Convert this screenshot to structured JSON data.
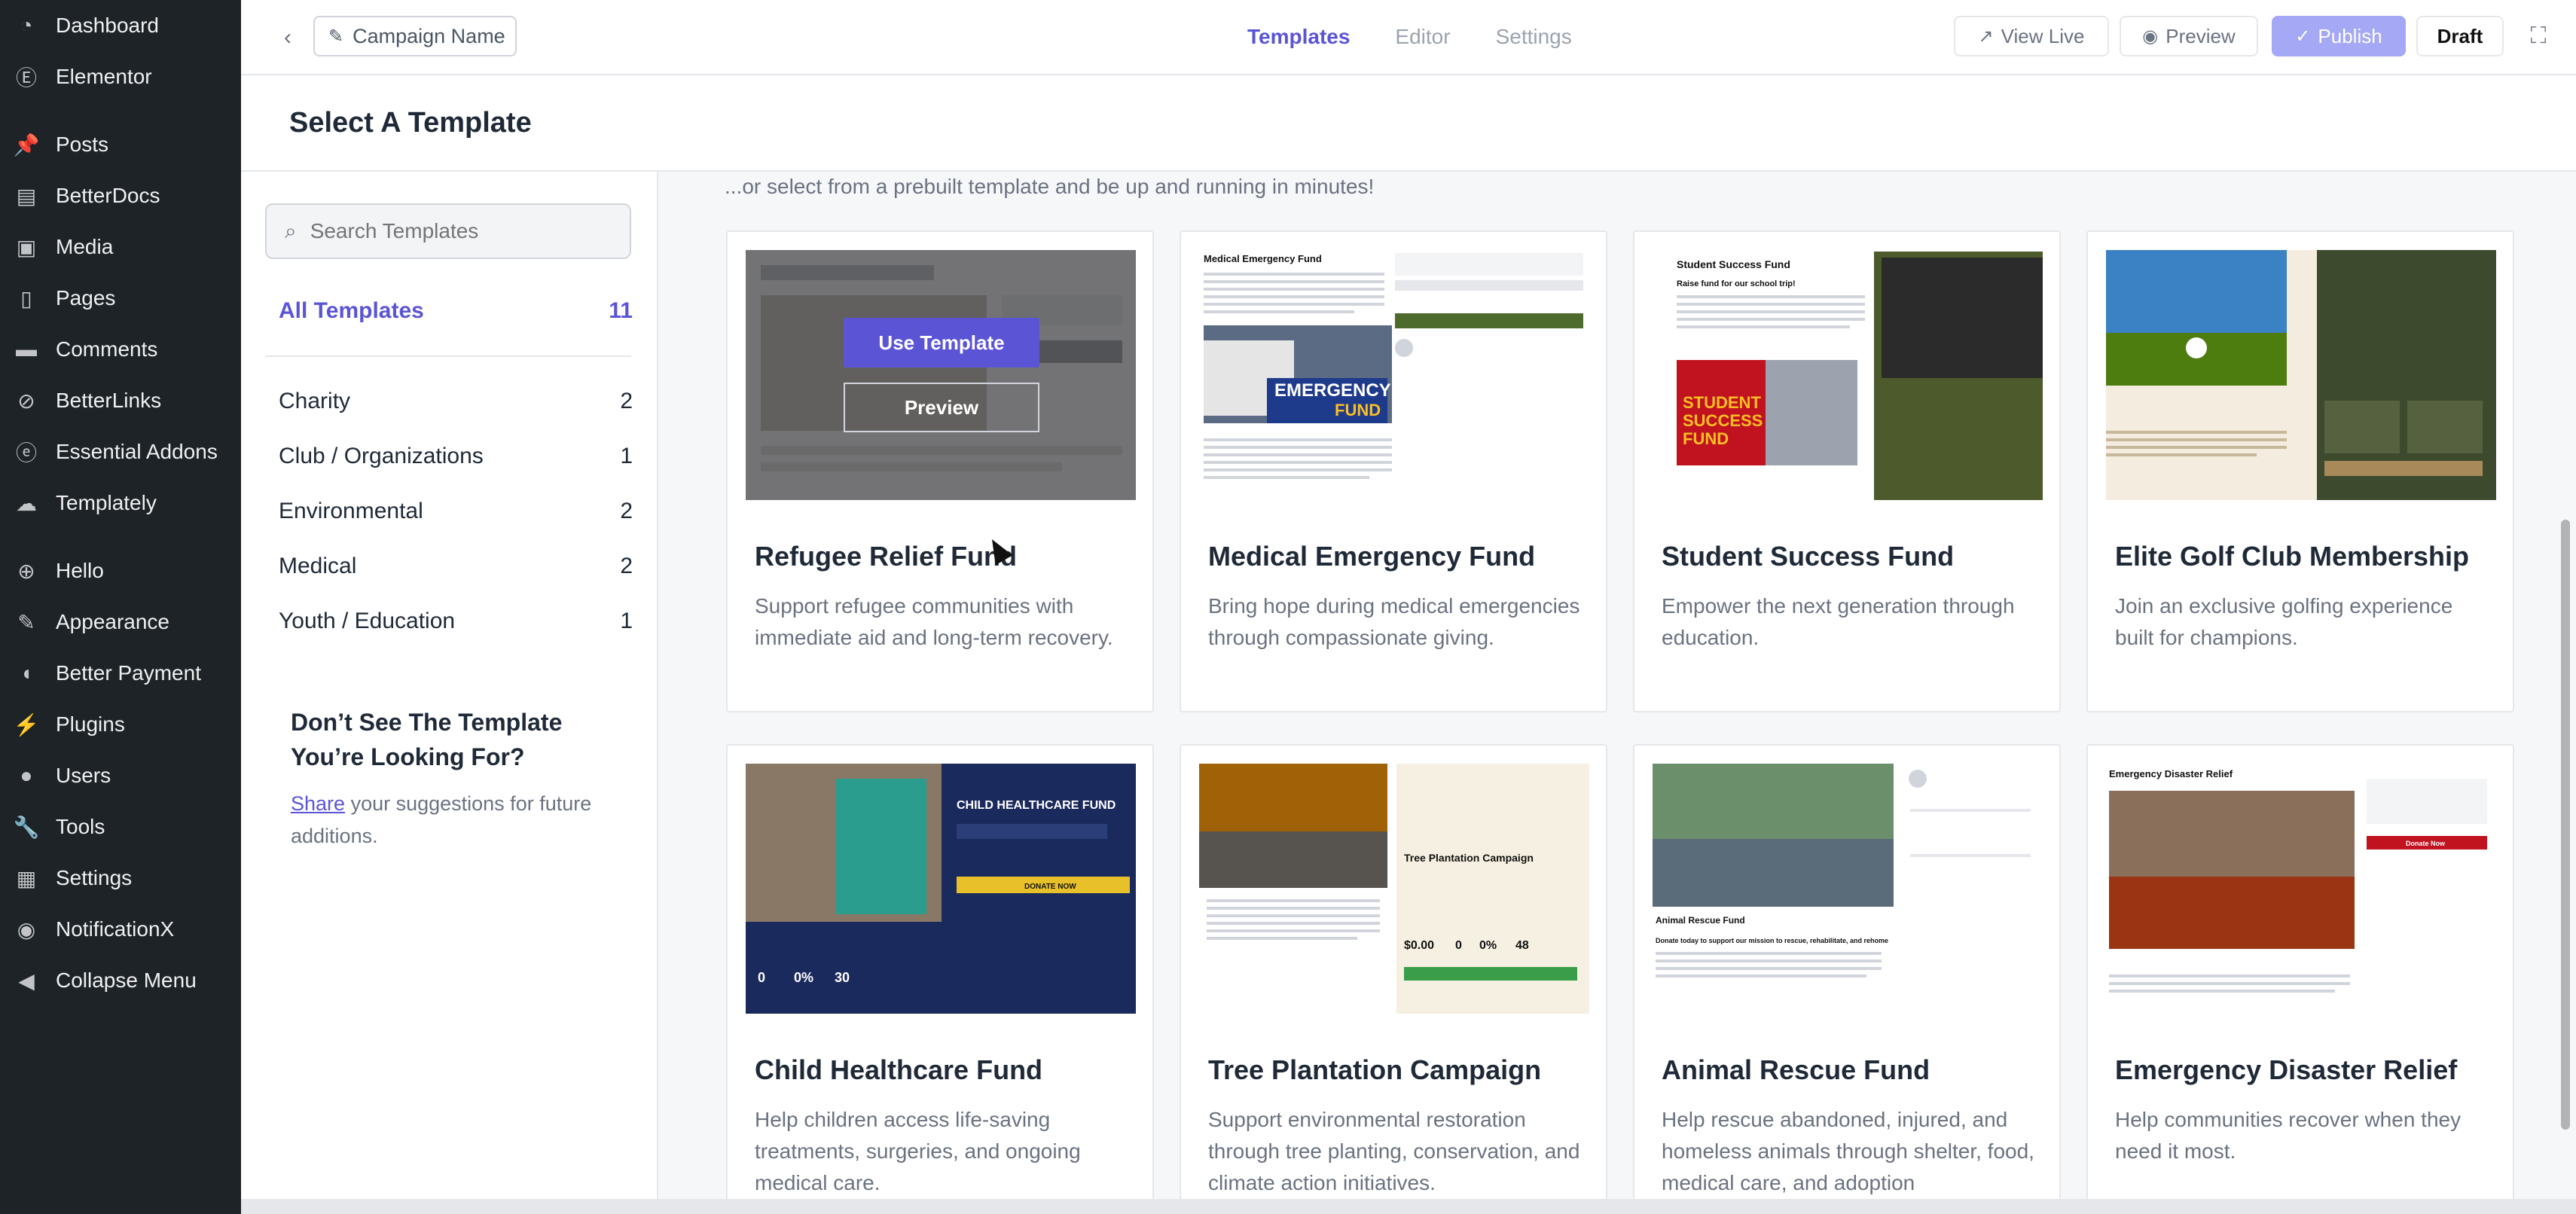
{
  "wp_menu": [
    {
      "label": "Dashboard",
      "icon": "dashboard-icon"
    },
    {
      "label": "Elementor",
      "icon": "elementor-icon"
    },
    {
      "label": "Posts",
      "icon": "pin-icon"
    },
    {
      "label": "BetterDocs",
      "icon": "docs-icon"
    },
    {
      "label": "Media",
      "icon": "media-icon"
    },
    {
      "label": "Pages",
      "icon": "page-icon"
    },
    {
      "label": "Comments",
      "icon": "comment-icon"
    },
    {
      "label": "BetterLinks",
      "icon": "link-icon"
    },
    {
      "label": "Essential Addons",
      "icon": "ea-icon"
    },
    {
      "label": "Templately",
      "icon": "templately-icon"
    },
    {
      "label": "Hello",
      "icon": "plus-circle-icon"
    },
    {
      "label": "Appearance",
      "icon": "brush-icon"
    },
    {
      "label": "Better Payment",
      "icon": "payment-icon"
    },
    {
      "label": "Plugins",
      "icon": "plug-icon"
    },
    {
      "label": "Users",
      "icon": "user-icon"
    },
    {
      "label": "Tools",
      "icon": "wrench-icon"
    },
    {
      "label": "Settings",
      "icon": "settings-icon"
    },
    {
      "label": "NotificationX",
      "icon": "notification-icon"
    },
    {
      "label": "Collapse Menu",
      "icon": "collapse-icon"
    }
  ],
  "topbar": {
    "campaign_name": "Campaign Name",
    "tabs": [
      "Templates",
      "Editor",
      "Settings"
    ],
    "view_live": "View Live",
    "preview": "Preview",
    "publish": "Publish",
    "draft": "Draft"
  },
  "page": {
    "title": "Select A Template",
    "intro": "...or select from a prebuilt template and be up and running in minutes!"
  },
  "sidebar": {
    "search_placeholder": "Search Templates",
    "all": {
      "label": "All Templates",
      "count": "11"
    },
    "categories": [
      {
        "label": "Charity",
        "count": "2"
      },
      {
        "label": "Club / Organizations",
        "count": "1"
      },
      {
        "label": "Environmental",
        "count": "2"
      },
      {
        "label": "Medical",
        "count": "2"
      },
      {
        "label": "Youth / Education",
        "count": "1"
      }
    ],
    "suggest_title": "Don’t See The Template You’re Looking For?",
    "suggest_link": "Share",
    "suggest_text": " your suggestions for future additions."
  },
  "templates": [
    {
      "title": "Refugee Relief Fund",
      "desc": "Support refugee communities with immediate aid and long-term recovery.",
      "use_label": "Use Template",
      "preview_label": "Preview"
    },
    {
      "title": "Medical Emergency Fund",
      "desc": "Bring hope during medical emergencies through compassionate giving."
    },
    {
      "title": "Student Success Fund",
      "desc": "Empower the next generation through education."
    },
    {
      "title": "Elite Golf Club Membership",
      "desc": "Join an exclusive golfing experience built for champions."
    },
    {
      "title": "Child Healthcare Fund",
      "desc": "Help children access life-saving treatments, surgeries, and ongoing medical care."
    },
    {
      "title": "Tree Plantation Campaign",
      "desc": "Support environmental restoration through tree planting, conservation, and climate action initiatives."
    },
    {
      "title": "Animal Rescue Fund",
      "desc": "Help rescue abandoned, injured, and homeless animals through shelter, food, medical care, and adoption"
    },
    {
      "title": "Emergency Disaster Relief",
      "desc": "Help communities recover when they need it most."
    }
  ],
  "thumb_text": {
    "medical": {
      "title": "Medical Emergency Fund",
      "badge": "EMERGENCY",
      "badge2": "FUND"
    },
    "student": {
      "title": "Student Success Fund",
      "subtitle": "Raise fund for our school trip!",
      "badge": "STUDENT",
      "badge2": "SUCCESS",
      "badge3": "FUND"
    },
    "child": {
      "title": "CHILD HEALTHCARE FUND",
      "cta": "DONATE NOW",
      "s1": "0",
      "s2": "0%",
      "s3": "30"
    },
    "tree": {
      "title": "Tree Plantation Campaign",
      "s1": "$0.00",
      "s2": "0",
      "s3": "0%",
      "s4": "48"
    },
    "animal": {
      "title": "Animal Rescue Fund",
      "subtitle": "Donate today to support our mission to rescue, rehabilitate, and rehome"
    },
    "disaster": {
      "title": "Emergency Disaster Relief",
      "cta": "Donate Now"
    }
  }
}
